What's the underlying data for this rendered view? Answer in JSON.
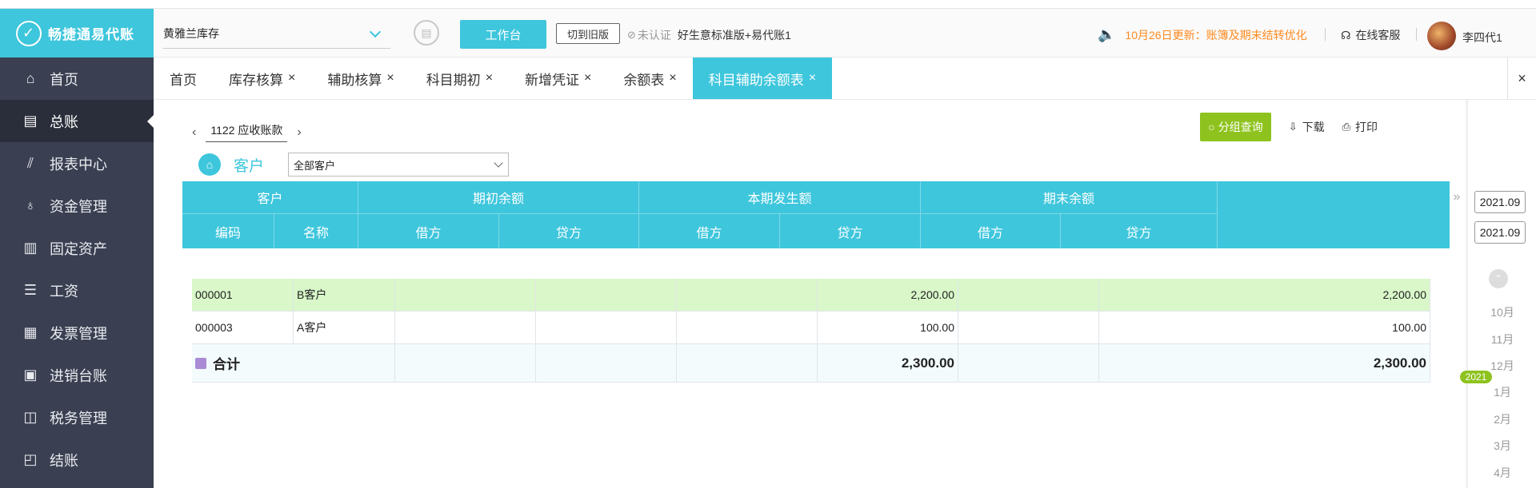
{
  "app": {
    "logo_text": "畅捷通易代账"
  },
  "sidebar": {
    "items": [
      {
        "label": "首页",
        "icon": "home-icon"
      },
      {
        "label": "总账",
        "icon": "ledger-icon",
        "active": true
      },
      {
        "label": "报表中心",
        "icon": "chart-icon"
      },
      {
        "label": "资金管理",
        "icon": "money-bag-icon"
      },
      {
        "label": "固定资产",
        "icon": "building-icon"
      },
      {
        "label": "工资",
        "icon": "payroll-icon"
      },
      {
        "label": "发票管理",
        "icon": "invoice-icon"
      },
      {
        "label": "进销台账",
        "icon": "stock-ledger-icon"
      },
      {
        "label": "税务管理",
        "icon": "tax-icon"
      },
      {
        "label": "结账",
        "icon": "checkout-icon"
      }
    ]
  },
  "header": {
    "company": "黄雅兰库存",
    "workbench_label": "工作台",
    "old_version_label": "切到旧版",
    "cert_status": "未认证",
    "edition": "好生意标准版+易代账1",
    "notice": "10月26日更新：账簿及期末结转优化",
    "service_label": "在线客服",
    "username": "李四代1"
  },
  "tabs": [
    {
      "label": "首页",
      "closable": false
    },
    {
      "label": "库存核算",
      "closable": true
    },
    {
      "label": "辅助核算",
      "closable": true
    },
    {
      "label": "科目期初",
      "closable": true
    },
    {
      "label": "新增凭证",
      "closable": true
    },
    {
      "label": "余额表",
      "closable": true
    },
    {
      "label": "科目辅助余额表",
      "closable": true,
      "active": true
    }
  ],
  "close_glyph": "×",
  "toolbar": {
    "account": "1122  应收账款",
    "group_query_label": "分组查询",
    "download_label": "下载",
    "print_label": "打印"
  },
  "filter": {
    "label": "客户",
    "value": "全部客户"
  },
  "table": {
    "group_headers": [
      "客户",
      "期初余额",
      "本期发生额",
      "期末余额"
    ],
    "sub_headers": [
      "编码",
      "名称",
      "借方",
      "贷方",
      "借方",
      "贷方",
      "借方",
      "贷方"
    ],
    "rows": [
      {
        "code": "000001",
        "name": "B客户",
        "open_debit": "",
        "open_credit": "",
        "period_debit": "",
        "period_credit": "2,200.00",
        "end_debit": "",
        "end_credit": "2,200.00",
        "highlight": true
      },
      {
        "code": "000003",
        "name": "A客户",
        "open_debit": "",
        "open_credit": "",
        "period_debit": "",
        "period_credit": "100.00",
        "end_debit": "",
        "end_credit": "100.00",
        "highlight": false
      }
    ],
    "total": {
      "label": "合计",
      "open_debit": "",
      "open_credit": "",
      "period_debit": "",
      "period_credit": "2,300.00",
      "end_debit": "",
      "end_credit": "2,300.00"
    }
  },
  "period": {
    "start": "2021.09",
    "end": "2021.09",
    "year_badge": "2021",
    "months": [
      "10月",
      "11月",
      "12月",
      "1月",
      "2月",
      "3月",
      "4月"
    ]
  },
  "colors": {
    "accent": "#3ec6dc",
    "sidebar_bg": "#3a3f51",
    "green": "#8ec31f",
    "notice": "#ff8a1f"
  }
}
